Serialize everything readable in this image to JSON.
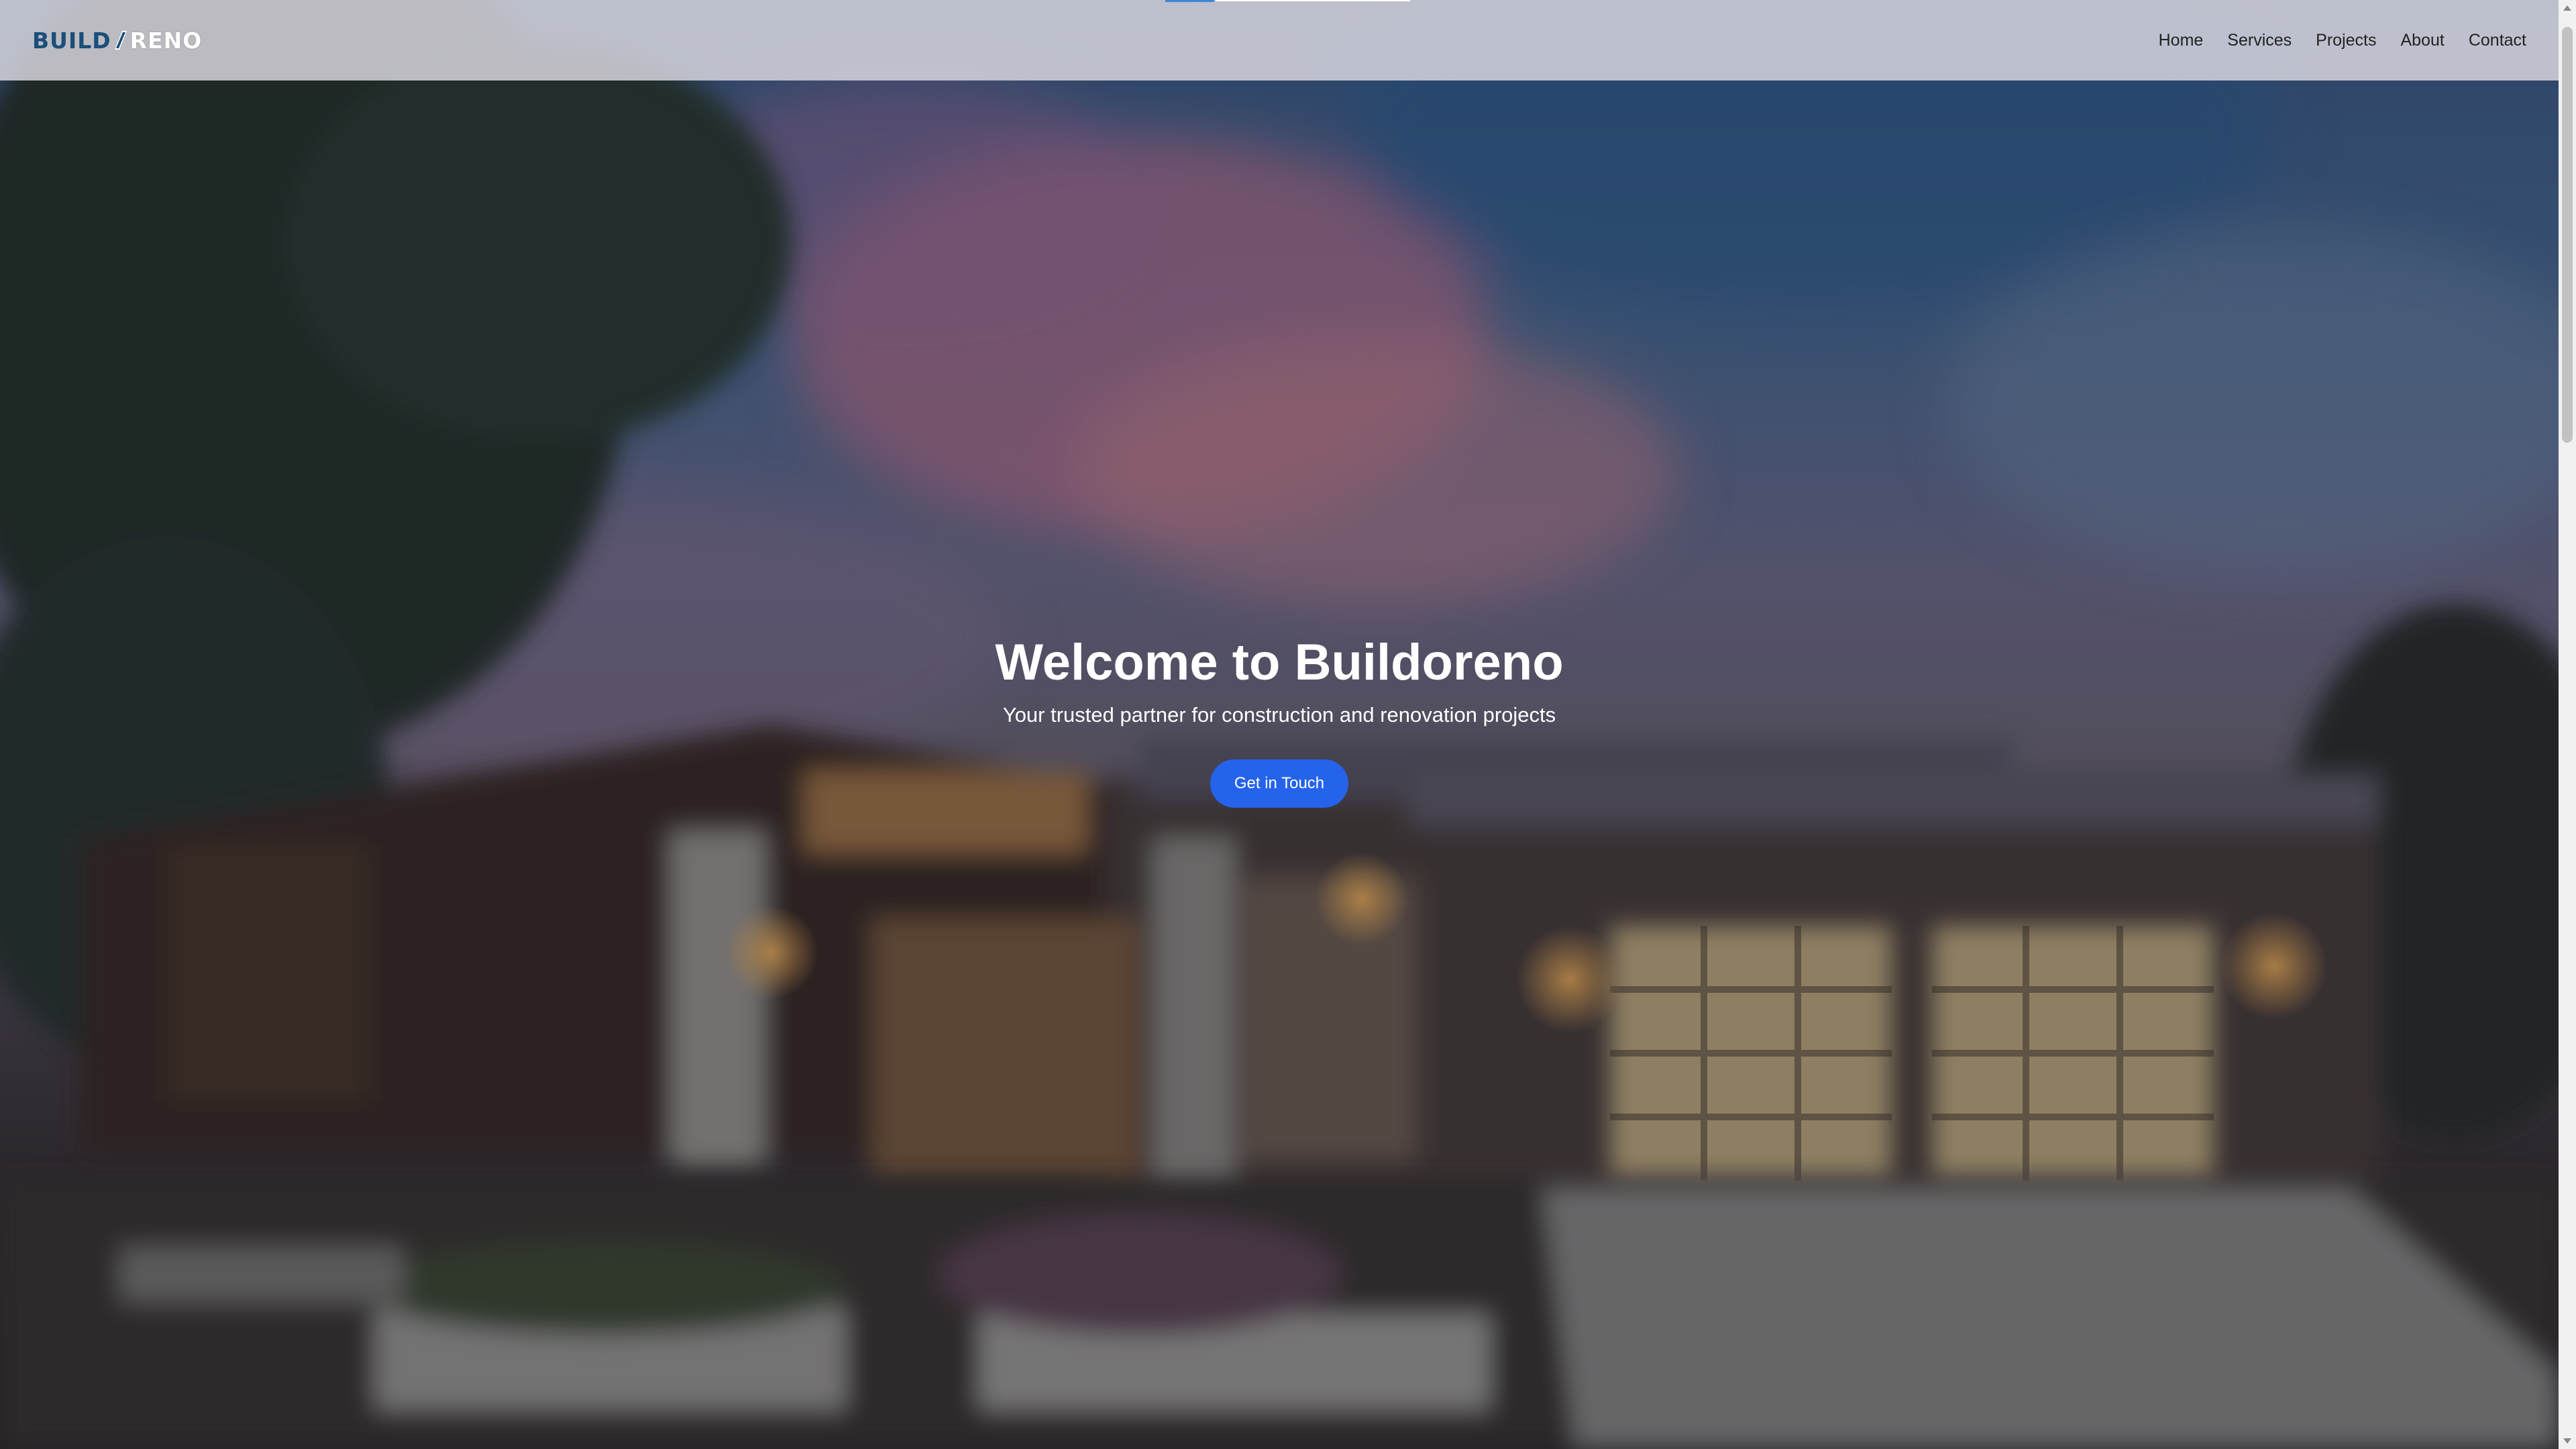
{
  "brand": {
    "logo_part1": "BUILD",
    "logo_part2": "RENO",
    "logo_mark_icon": "slash-mark-icon",
    "accent_color": "#1a4f7a"
  },
  "nav": {
    "items": [
      {
        "label": "Home"
      },
      {
        "label": "Services"
      },
      {
        "label": "Projects"
      },
      {
        "label": "About"
      },
      {
        "label": "Contact"
      }
    ]
  },
  "hero": {
    "title": "Welcome to Buildoreno",
    "subtitle": "Your trusted partner for construction and renovation projects",
    "cta_label": "Get in Touch",
    "cta_color": "#2563eb",
    "background_image": "modern house at dusk"
  }
}
